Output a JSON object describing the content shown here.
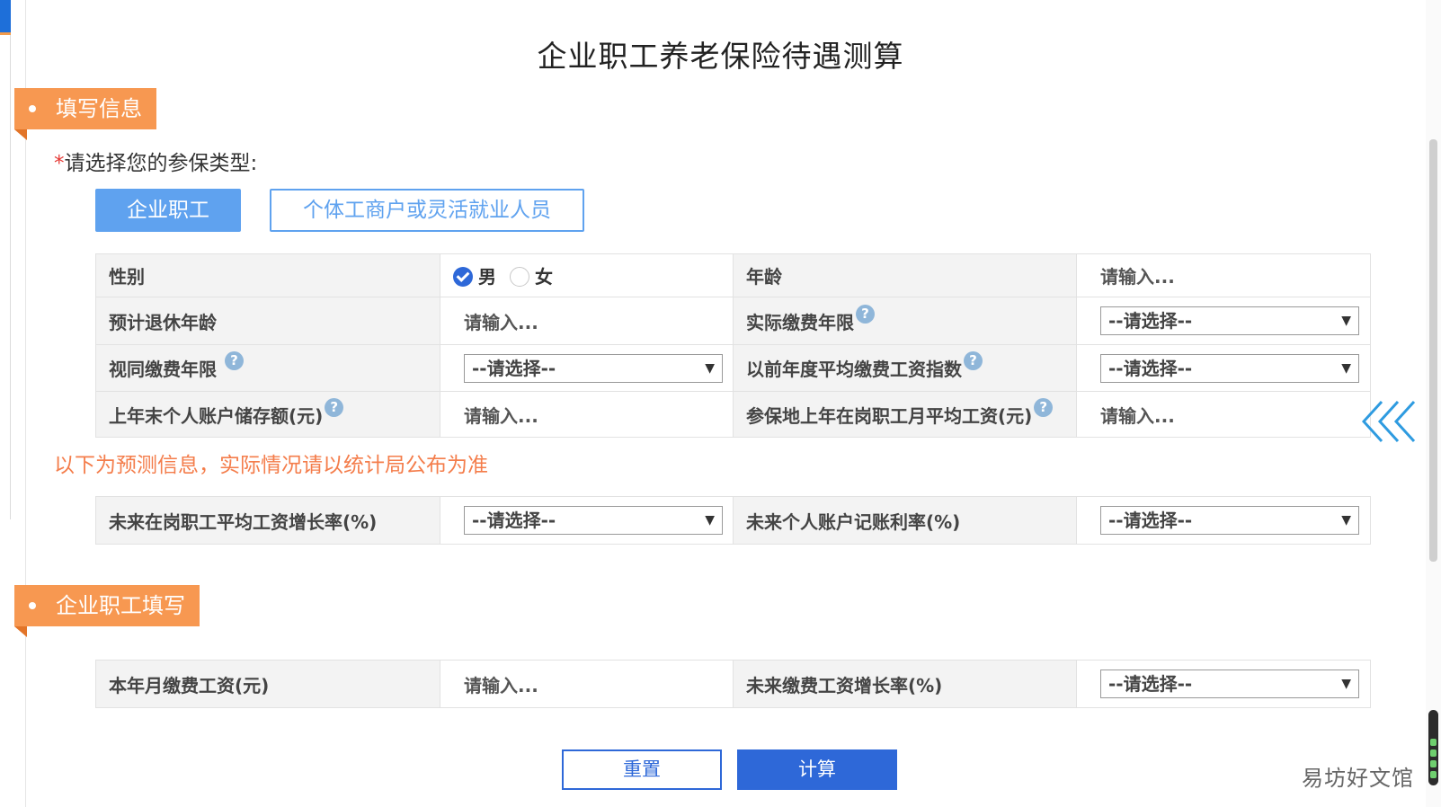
{
  "page": {
    "title": "企业职工养老保险待遇测算"
  },
  "sections": {
    "fill_info": "填写信息",
    "employee_fill": "企业职工填写"
  },
  "insurance_type": {
    "required_mark": "*",
    "label": "请选择您的参保类型:",
    "options": [
      "企业职工",
      "个体工商户或灵活就业人员"
    ],
    "selected": "企业职工"
  },
  "basic_form": {
    "gender": {
      "label": "性别",
      "options": [
        "男",
        "女"
      ],
      "selected": "男"
    },
    "age": {
      "label": "年龄",
      "placeholder": "请输入..."
    },
    "expected_retire_age": {
      "label": "预计退休年龄",
      "placeholder": "请输入..."
    },
    "actual_pay_years": {
      "label": "实际缴费年限",
      "value": "--请选择--"
    },
    "deemed_pay_years": {
      "label": "视同缴费年限",
      "value": "--请选择--"
    },
    "avg_wage_index": {
      "label": "以前年度平均缴费工资指数",
      "value": "--请选择--"
    },
    "account_balance": {
      "label": "上年末个人账户储存额(元)",
      "placeholder": "请输入..."
    },
    "local_avg_wage": {
      "label": "参保地上年在岗职工月平均工资(元)",
      "placeholder": "请输入..."
    }
  },
  "notice": "以下为预测信息，实际情况请以统计局公布为准",
  "forecast_form": {
    "wage_growth": {
      "label": "未来在岗职工平均工资增长率(%)",
      "value": "--请选择--"
    },
    "account_rate": {
      "label": "未来个人账户记账利率(%)",
      "value": "--请选择--"
    }
  },
  "employee_form": {
    "monthly_wage": {
      "label": "本年月缴费工资(元)",
      "placeholder": "请输入..."
    },
    "pay_wage_growth": {
      "label": "未来缴费工资增长率(%)",
      "value": "--请选择--"
    }
  },
  "buttons": {
    "reset": "重置",
    "calculate": "计算"
  },
  "icons": {
    "help": "?",
    "dropdown": "▼"
  },
  "watermark": "易坊好文馆",
  "colors": {
    "accent_blue": "#2e68d8",
    "tag_orange": "#f79851",
    "notice_orange": "#f47d4b",
    "light_blue": "#5fa2ef"
  }
}
